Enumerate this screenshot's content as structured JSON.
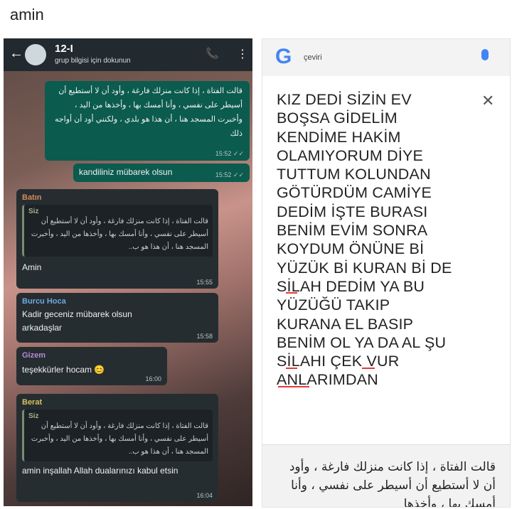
{
  "caption": "amin",
  "whatsapp": {
    "group_title": "12-I",
    "group_subtitle": "grup bilgisi için dokunun",
    "messages": [
      {
        "kind": "outgoing",
        "text_arabic": "قالت الفتاة ، إذا كانت منزلك فارغة ، وأود أن لا أستطيع أن أسيطر على نفسي ، وأنا أمسك بها ، وأخذها من اليد ، وأخبرت المسجد هنا ، أن هذا هو بلدي ، ولكنني أود أن أواجه ذلك",
        "time": "15:52 ✓✓"
      },
      {
        "kind": "outgoing",
        "text": "kandiliniz mübarek olsun",
        "time": "15:52 ✓✓"
      },
      {
        "kind": "incoming",
        "sender": "Batın",
        "quote_name": "Siz",
        "quote_text": "قالت الفتاة ، إذا كانت منزلك فارغة ، وأود أن لا أستطيع أن أسيطر على نفسي ، وأنا أمسك بها ، وأخذها من اليد ، وأخبرت المسجد هنا ، أن هذا هو ب..",
        "text": "Amin",
        "time": "15:55"
      },
      {
        "kind": "incoming",
        "sender": "Burcu Hoca",
        "text": "Kadir geceniz mübarek olsun arkadaşlar",
        "time": "15:58"
      },
      {
        "kind": "incoming",
        "sender": "Gizem",
        "text": "teşekkürler hocam 😊",
        "time": "16:00"
      },
      {
        "kind": "incoming",
        "sender": "Berat",
        "quote_name": "Siz",
        "quote_text": "قالت الفتاة ، إذا كانت منزلك فارغة ، وأود أن لا أستطيع أن أسيطر على نفسي ، وأنا أمسك بها ، وأخذها من اليد ، وأخبرت المسجد هنا ، أن هذا هو ب..",
        "text": "amin inşallah Allah dualarınızı kabul etsin",
        "time": "16:04"
      }
    ]
  },
  "google": {
    "query": "çeviri",
    "translation_lines": [
      "KIZ DEDİ SİZİN EV",
      "BOŞSA GİDELİM",
      "KENDİME HAKİM",
      "OLAMIYORUM DİYE",
      "TUTTUM KOLUNDAN",
      "GÖTÜRDÜM CAMİYE",
      "DEDİM İŞTE BURASI",
      "BENİM EVİM SONRA",
      "KOYDUM ÖNÜNE Bİ",
      "YÜZÜK Bİ KURAN Bİ DE",
      "SİLAH DEDİM YA BU",
      "YÜZÜĞÜ TAKIP",
      "KURANA EL BASIP",
      "BENİM OL YA DA AL ŞU",
      "SİLAHI ÇEK VUR",
      "ANLARIMDAN"
    ],
    "arabic_source": "قالت الفتاة ، إذا كانت منزلك فارغة ، وأود أن لا أستطيع أن أسيطر على نفسي ، وأنا أمسك بها ، وأخذها"
  }
}
